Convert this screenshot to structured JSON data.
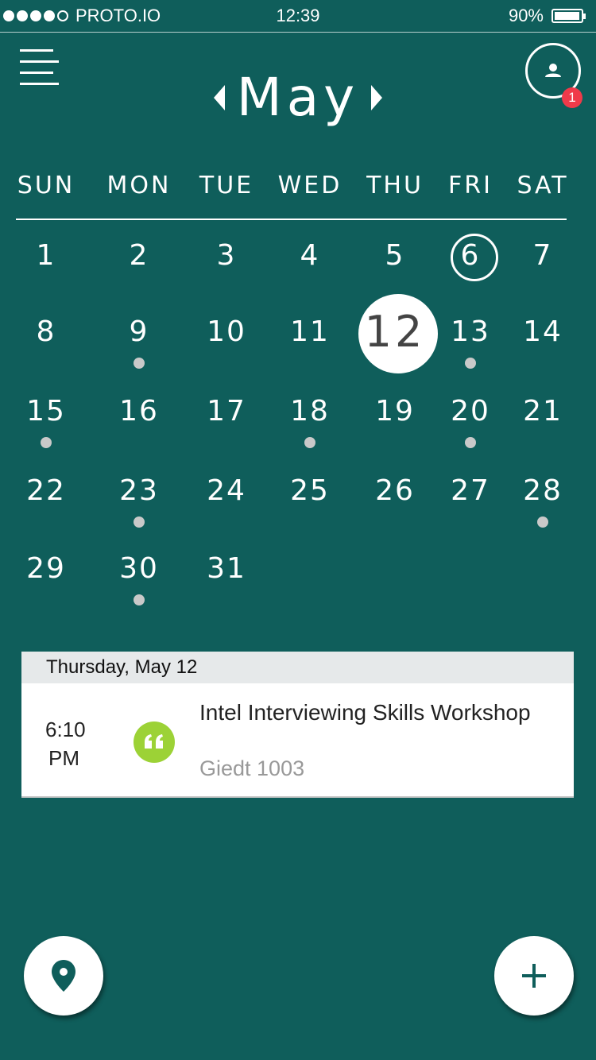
{
  "status_bar": {
    "carrier": "PROTO.IO",
    "time": "12:39",
    "battery": "90%"
  },
  "header": {
    "month": "May",
    "notification_count": "1"
  },
  "weekdays": [
    "SUN",
    "MON",
    "TUE",
    "WED",
    "THU",
    "FRI",
    "SAT"
  ],
  "calendar": {
    "days": [
      "1",
      "2",
      "3",
      "4",
      "5",
      "6",
      "7",
      "8",
      "9",
      "10",
      "11",
      "12",
      "13",
      "14",
      "15",
      "16",
      "17",
      "18",
      "19",
      "20",
      "21",
      "22",
      "23",
      "24",
      "25",
      "26",
      "27",
      "28",
      "29",
      "30",
      "31"
    ],
    "today": "6",
    "selected": "12",
    "days_with_events": [
      "9",
      "13",
      "15",
      "18",
      "20",
      "23",
      "28",
      "30"
    ]
  },
  "event_list": {
    "date_header": "Thursday, May 12",
    "events": [
      {
        "time": "6:10\nPM",
        "title": "Intel Interviewing Skills Workshop",
        "location": "Giedt 1003",
        "icon": "quote-icon"
      }
    ]
  },
  "colors": {
    "background": "#0f5e5b",
    "event_dot": "#c9c9c9",
    "badge": "#f03a4a",
    "event_icon": "#9cd236"
  }
}
